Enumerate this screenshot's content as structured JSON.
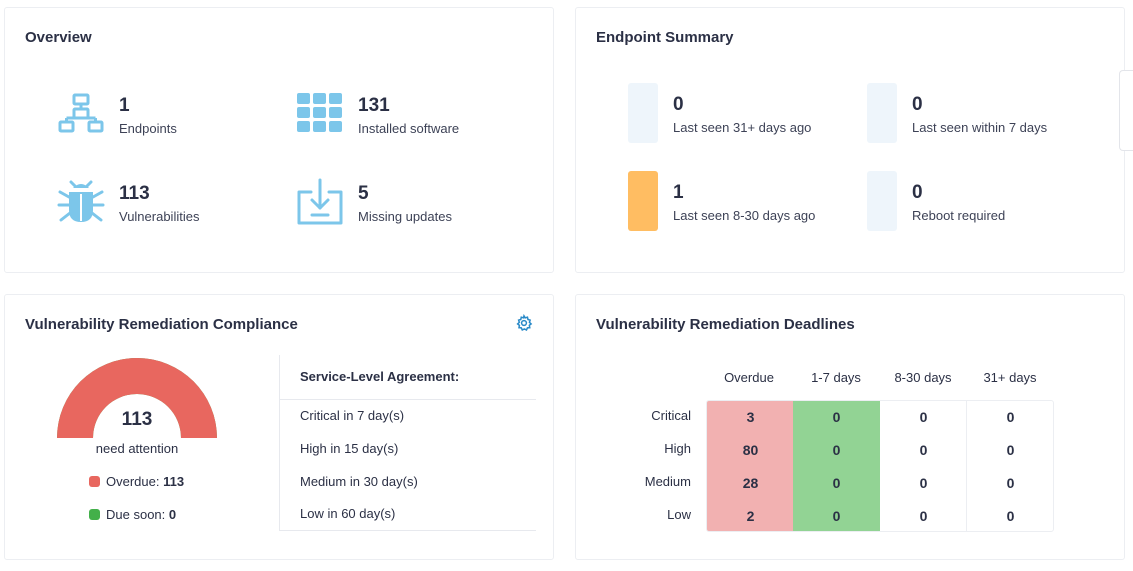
{
  "overview": {
    "title": "Overview",
    "stats": [
      {
        "icon": "network-icon",
        "value": "1",
        "label": "Endpoints"
      },
      {
        "icon": "software-grid-icon",
        "value": "131",
        "label": "Installed software"
      },
      {
        "icon": "bug-icon",
        "value": "113",
        "label": "Vulnerabilities"
      },
      {
        "icon": "download-tray-icon",
        "value": "5",
        "label": "Missing updates"
      }
    ]
  },
  "endpoint_summary": {
    "title": "Endpoint Summary",
    "items": [
      {
        "value": "0",
        "label": "Last seen 31+ days ago",
        "status": "normal"
      },
      {
        "value": "0",
        "label": "Last seen within 7 days",
        "status": "normal"
      },
      {
        "value": "1",
        "label": "Last seen 8-30 days ago",
        "status": "warning"
      },
      {
        "value": "0",
        "label": "Reboot required",
        "status": "normal"
      }
    ]
  },
  "compliance": {
    "title": "Vulnerability Remediation Compliance",
    "gauge_value": "113",
    "gauge_label": "need attention",
    "gauge_overdue_fraction": 1.0,
    "legend": {
      "overdue_label": "Overdue: ",
      "overdue_value": "113",
      "due_soon_label": "Due soon: ",
      "due_soon_value": "0"
    },
    "sla": {
      "heading": "Service-Level Agreement:",
      "items": [
        "Critical in 7 day(s)",
        "High in 15 day(s)",
        "Medium in 30 day(s)",
        "Low in 60 day(s)"
      ]
    }
  },
  "deadlines": {
    "title": "Vulnerability Remediation Deadlines",
    "columns": [
      "Overdue",
      "1-7 days",
      "8-30 days",
      "31+ days"
    ],
    "rows": [
      {
        "label": "Critical",
        "values": [
          "3",
          "0",
          "0",
          "0"
        ]
      },
      {
        "label": "High",
        "values": [
          "80",
          "0",
          "0",
          "0"
        ]
      },
      {
        "label": "Medium",
        "values": [
          "28",
          "0",
          "0",
          "0"
        ]
      },
      {
        "label": "Low",
        "values": [
          "2",
          "0",
          "0",
          "0"
        ]
      }
    ]
  },
  "colors": {
    "icon_blue": "#7cc6ea",
    "warning": "#ffbd62",
    "overdue_red": "#e8675f",
    "due_soon_green": "#43b04a",
    "overdue_cell": "#f2b1b1",
    "soon_cell": "#92d394",
    "gear_blue": "#2a8ac8"
  }
}
